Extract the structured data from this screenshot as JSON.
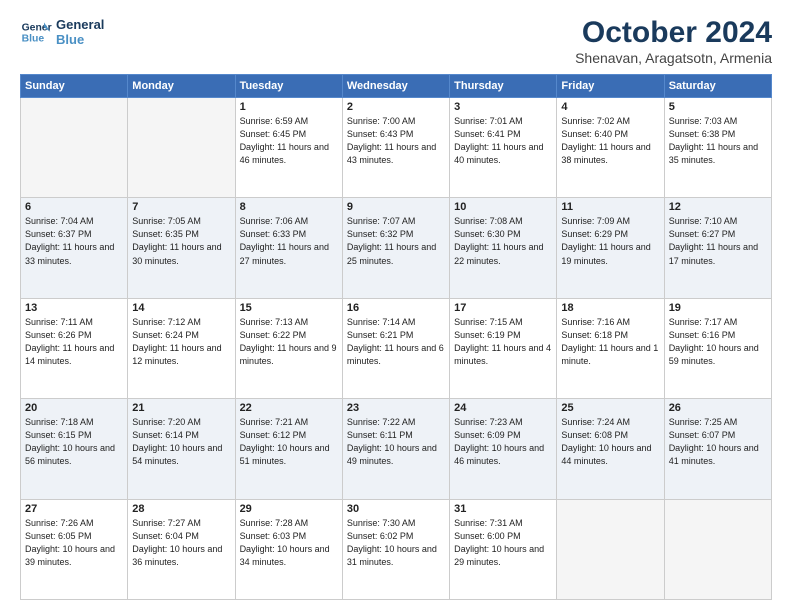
{
  "logo": {
    "line1": "General",
    "line2": "Blue"
  },
  "title": "October 2024",
  "subtitle": "Shenavan, Aragatsotn, Armenia",
  "weekdays": [
    "Sunday",
    "Monday",
    "Tuesday",
    "Wednesday",
    "Thursday",
    "Friday",
    "Saturday"
  ],
  "days": [
    {
      "num": "",
      "info": ""
    },
    {
      "num": "",
      "info": ""
    },
    {
      "num": "1",
      "info": "Sunrise: 6:59 AM\nSunset: 6:45 PM\nDaylight: 11 hours and 46 minutes."
    },
    {
      "num": "2",
      "info": "Sunrise: 7:00 AM\nSunset: 6:43 PM\nDaylight: 11 hours and 43 minutes."
    },
    {
      "num": "3",
      "info": "Sunrise: 7:01 AM\nSunset: 6:41 PM\nDaylight: 11 hours and 40 minutes."
    },
    {
      "num": "4",
      "info": "Sunrise: 7:02 AM\nSunset: 6:40 PM\nDaylight: 11 hours and 38 minutes."
    },
    {
      "num": "5",
      "info": "Sunrise: 7:03 AM\nSunset: 6:38 PM\nDaylight: 11 hours and 35 minutes."
    },
    {
      "num": "6",
      "info": "Sunrise: 7:04 AM\nSunset: 6:37 PM\nDaylight: 11 hours and 33 minutes."
    },
    {
      "num": "7",
      "info": "Sunrise: 7:05 AM\nSunset: 6:35 PM\nDaylight: 11 hours and 30 minutes."
    },
    {
      "num": "8",
      "info": "Sunrise: 7:06 AM\nSunset: 6:33 PM\nDaylight: 11 hours and 27 minutes."
    },
    {
      "num": "9",
      "info": "Sunrise: 7:07 AM\nSunset: 6:32 PM\nDaylight: 11 hours and 25 minutes."
    },
    {
      "num": "10",
      "info": "Sunrise: 7:08 AM\nSunset: 6:30 PM\nDaylight: 11 hours and 22 minutes."
    },
    {
      "num": "11",
      "info": "Sunrise: 7:09 AM\nSunset: 6:29 PM\nDaylight: 11 hours and 19 minutes."
    },
    {
      "num": "12",
      "info": "Sunrise: 7:10 AM\nSunset: 6:27 PM\nDaylight: 11 hours and 17 minutes."
    },
    {
      "num": "13",
      "info": "Sunrise: 7:11 AM\nSunset: 6:26 PM\nDaylight: 11 hours and 14 minutes."
    },
    {
      "num": "14",
      "info": "Sunrise: 7:12 AM\nSunset: 6:24 PM\nDaylight: 11 hours and 12 minutes."
    },
    {
      "num": "15",
      "info": "Sunrise: 7:13 AM\nSunset: 6:22 PM\nDaylight: 11 hours and 9 minutes."
    },
    {
      "num": "16",
      "info": "Sunrise: 7:14 AM\nSunset: 6:21 PM\nDaylight: 11 hours and 6 minutes."
    },
    {
      "num": "17",
      "info": "Sunrise: 7:15 AM\nSunset: 6:19 PM\nDaylight: 11 hours and 4 minutes."
    },
    {
      "num": "18",
      "info": "Sunrise: 7:16 AM\nSunset: 6:18 PM\nDaylight: 11 hours and 1 minute."
    },
    {
      "num": "19",
      "info": "Sunrise: 7:17 AM\nSunset: 6:16 PM\nDaylight: 10 hours and 59 minutes."
    },
    {
      "num": "20",
      "info": "Sunrise: 7:18 AM\nSunset: 6:15 PM\nDaylight: 10 hours and 56 minutes."
    },
    {
      "num": "21",
      "info": "Sunrise: 7:20 AM\nSunset: 6:14 PM\nDaylight: 10 hours and 54 minutes."
    },
    {
      "num": "22",
      "info": "Sunrise: 7:21 AM\nSunset: 6:12 PM\nDaylight: 10 hours and 51 minutes."
    },
    {
      "num": "23",
      "info": "Sunrise: 7:22 AM\nSunset: 6:11 PM\nDaylight: 10 hours and 49 minutes."
    },
    {
      "num": "24",
      "info": "Sunrise: 7:23 AM\nSunset: 6:09 PM\nDaylight: 10 hours and 46 minutes."
    },
    {
      "num": "25",
      "info": "Sunrise: 7:24 AM\nSunset: 6:08 PM\nDaylight: 10 hours and 44 minutes."
    },
    {
      "num": "26",
      "info": "Sunrise: 7:25 AM\nSunset: 6:07 PM\nDaylight: 10 hours and 41 minutes."
    },
    {
      "num": "27",
      "info": "Sunrise: 7:26 AM\nSunset: 6:05 PM\nDaylight: 10 hours and 39 minutes."
    },
    {
      "num": "28",
      "info": "Sunrise: 7:27 AM\nSunset: 6:04 PM\nDaylight: 10 hours and 36 minutes."
    },
    {
      "num": "29",
      "info": "Sunrise: 7:28 AM\nSunset: 6:03 PM\nDaylight: 10 hours and 34 minutes."
    },
    {
      "num": "30",
      "info": "Sunrise: 7:30 AM\nSunset: 6:02 PM\nDaylight: 10 hours and 31 minutes."
    },
    {
      "num": "31",
      "info": "Sunrise: 7:31 AM\nSunset: 6:00 PM\nDaylight: 10 hours and 29 minutes."
    },
    {
      "num": "",
      "info": ""
    },
    {
      "num": "",
      "info": ""
    },
    {
      "num": "",
      "info": ""
    }
  ]
}
